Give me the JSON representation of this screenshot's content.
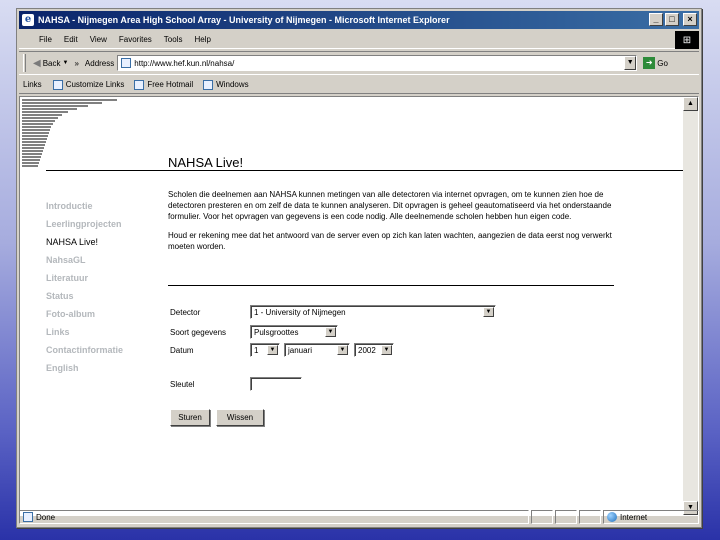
{
  "window": {
    "title": "NAHSA - Nijmegen Area High School Array - University of Nijmegen - Microsoft Internet Explorer",
    "controls": {
      "minimize": "_",
      "maximize": "□",
      "close": "×"
    }
  },
  "menubar": {
    "items": [
      "File",
      "Edit",
      "View",
      "Favorites",
      "Tools",
      "Help"
    ]
  },
  "toolbar": {
    "back_label": "Back",
    "address_label": "Address",
    "address_value": "http://www.hef.kun.nl/nahsa/",
    "go_label": "Go",
    "chevron": "»"
  },
  "linksbar": {
    "label": "Links",
    "items": [
      "Customize Links",
      "Free Hotmail",
      "Windows"
    ]
  },
  "page": {
    "title": "NAHSA Live!",
    "nav": [
      {
        "label": "Introductie",
        "active": false
      },
      {
        "label": "Leerlingprojecten",
        "active": false
      },
      {
        "label": "NAHSA Live!",
        "active": true
      },
      {
        "label": "NahsaGL",
        "active": false
      },
      {
        "label": "Literatuur",
        "active": false
      },
      {
        "label": "Status",
        "active": false
      },
      {
        "label": "Foto-album",
        "active": false
      },
      {
        "label": "Links",
        "active": false
      },
      {
        "label": "Contactinformatie",
        "active": false
      },
      {
        "label": "English",
        "active": false
      }
    ],
    "paragraphs": [
      "Scholen die deelnemen aan NAHSA kunnen metingen van alle detectoren via internet opvragen, om te kunnen zien hoe de detectoren presteren en om zelf de data te kunnen analyseren. Dit opvragen is geheel geautomatiseerd via het onderstaande formulier. Voor het opvragen van gegevens is een code nodig. Alle deelnemende scholen hebben hun eigen code.",
      "Houd er rekening mee dat het antwoord van de server even op zich kan laten wachten, aangezien de data eerst nog verwerkt moeten worden."
    ],
    "form": {
      "detector_label": "Detector",
      "detector_value": "1 - University of Nijmegen",
      "type_label": "Soort gegevens",
      "type_value": "Pulsgroottes",
      "date_label": "Datum",
      "day_value": "1",
      "month_value": "januari",
      "year_value": "2002",
      "key_label": "Sleutel",
      "key_value": "",
      "submit_label": "Sturen",
      "reset_label": "Wissen"
    }
  },
  "status": {
    "text": "Done",
    "zone": "Internet"
  }
}
